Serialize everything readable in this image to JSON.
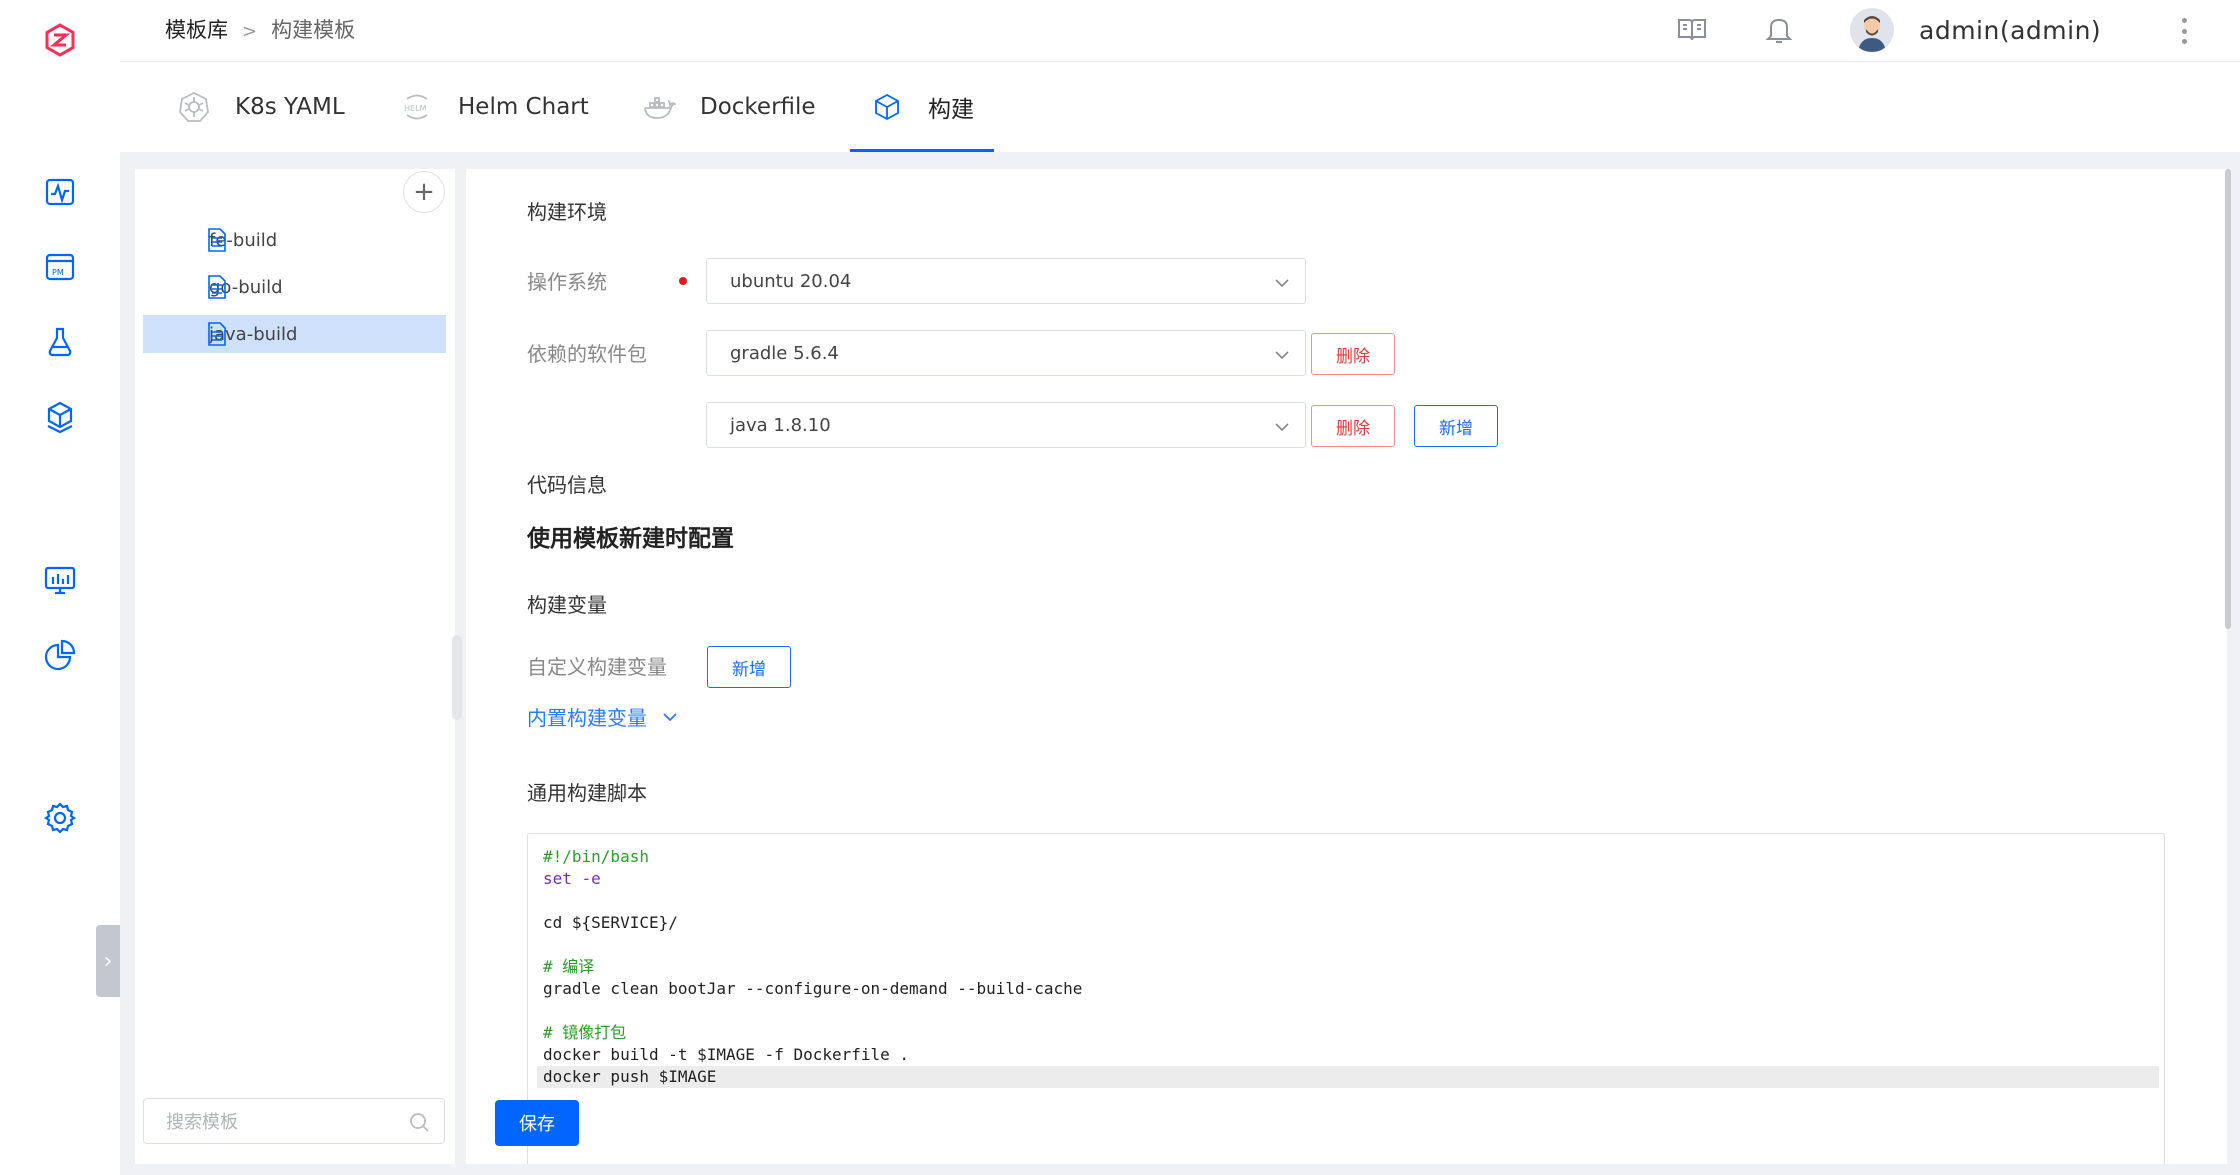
{
  "breadcrumb": {
    "root": "模板库",
    "separator": ">",
    "current": "构建模板"
  },
  "user": {
    "name": "admin(admin)"
  },
  "tabs": [
    {
      "label": "K8s YAML",
      "icon": "kubernetes-icon"
    },
    {
      "label": "Helm Chart",
      "icon": "helm-icon"
    },
    {
      "label": "Dockerfile",
      "icon": "docker-icon"
    },
    {
      "label": "构建",
      "icon": "cube-icon",
      "active": true
    }
  ],
  "sidebar": {
    "add_label": "+",
    "files": [
      {
        "name": "fe-build"
      },
      {
        "name": "go-build"
      },
      {
        "name": "java-build",
        "selected": true
      }
    ],
    "search_placeholder": "搜索模板"
  },
  "main": {
    "build_env_title": "构建环境",
    "os_label": "操作系统",
    "os_value": "ubuntu 20.04",
    "deps_label": "依赖的软件包",
    "deps": [
      {
        "value": "gradle 5.6.4",
        "delete_label": "删除"
      },
      {
        "value": "java 1.8.10",
        "delete_label": "删除",
        "add_label": "新增"
      }
    ],
    "code_info_title": "代码信息",
    "code_info_text": "使用模板新建时配置",
    "build_vars_title": "构建变量",
    "custom_vars_label": "自定义构建变量",
    "custom_vars_add": "新增",
    "builtin_vars_label": "内置构建变量",
    "script_title": "通用构建脚本",
    "script_lines": [
      "#!/bin/bash",
      "set -e",
      "",
      "cd ${SERVICE}/",
      "",
      "# 编译",
      "gradle clean bootJar --configure-on-demand --build-cache",
      "",
      "# 镜像打包",
      "docker build -t $IMAGE -f Dockerfile .",
      "docker push $IMAGE"
    ],
    "save_label": "保存"
  },
  "colors": {
    "accent": "#0066ff",
    "danger": "#e03a3a",
    "selected_bg": "#cfe0fb"
  }
}
